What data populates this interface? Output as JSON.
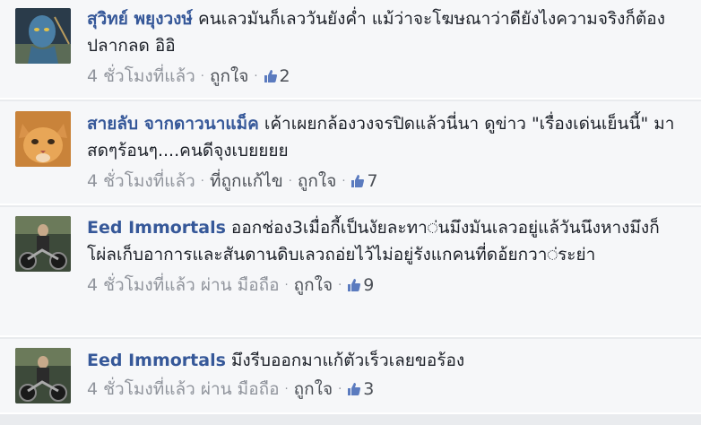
{
  "comments": [
    {
      "author": "สุวิทย์ พยุงวงษ์",
      "text": "คนเลวมันก็เลววันยังค่ำ แม้ว่าจะโฆษณาว่าดียังไงความจริงก็ต้องปลากลด อิอิ",
      "time": "4 ชั่วโมงที่แล้ว",
      "via": "",
      "edited": "",
      "like_label": "ถูกใจ",
      "likes": "2",
      "avatar_icon": "blue-alien-avatar"
    },
    {
      "author": "สายลับ จากดาวนาแม็ค",
      "text": "เค้าเผยกล้องวงจรปิดแล้วนี่นา ดูข่าว \"เรื่องเด่นเย็นนี้\" มาสดๆร้อนๆ....คนดีจุงเบยยยย",
      "time": "4 ชั่วโมงที่แล้ว",
      "via": "",
      "edited": "ที่ถูกแก้ไข",
      "like_label": "ถูกใจ",
      "likes": "7",
      "avatar_icon": "orange-cat-avatar"
    },
    {
      "author": "Eed Immortals",
      "text": "ออกช่อง3เมื่อกี้เป็นงัยละทา◌่นมึงมันเลวอยู่แล้วันนึงหางมึงก็โผ่ลเก็บอาการและสันดานดิบเลวถอ่ยไว้ไม่อยู่รังแกคนที่ดอ้ยกวา◌่ระย่า",
      "time": "4 ชั่วโมงที่แล้ว",
      "via": "ผ่าน มือถือ",
      "edited": "",
      "like_label": "ถูกใจ",
      "likes": "9",
      "avatar_icon": "motorcycle-avatar"
    },
    {
      "author": "Eed Immortals",
      "text": "มึงรีบออกมาแก้ตัวเร็วเลยขอร้อง",
      "time": "4 ชั่วโมงที่แล้ว",
      "via": "ผ่าน มือถือ",
      "edited": "",
      "like_label": "ถูกใจ",
      "likes": "3",
      "avatar_icon": "motorcycle-avatar"
    }
  ],
  "icons": {
    "like": "thumbs-up-icon"
  },
  "colors": {
    "author": "#365899",
    "meta": "#90949c",
    "row_bg": "#f6f7f9",
    "text": "#1d2129"
  }
}
